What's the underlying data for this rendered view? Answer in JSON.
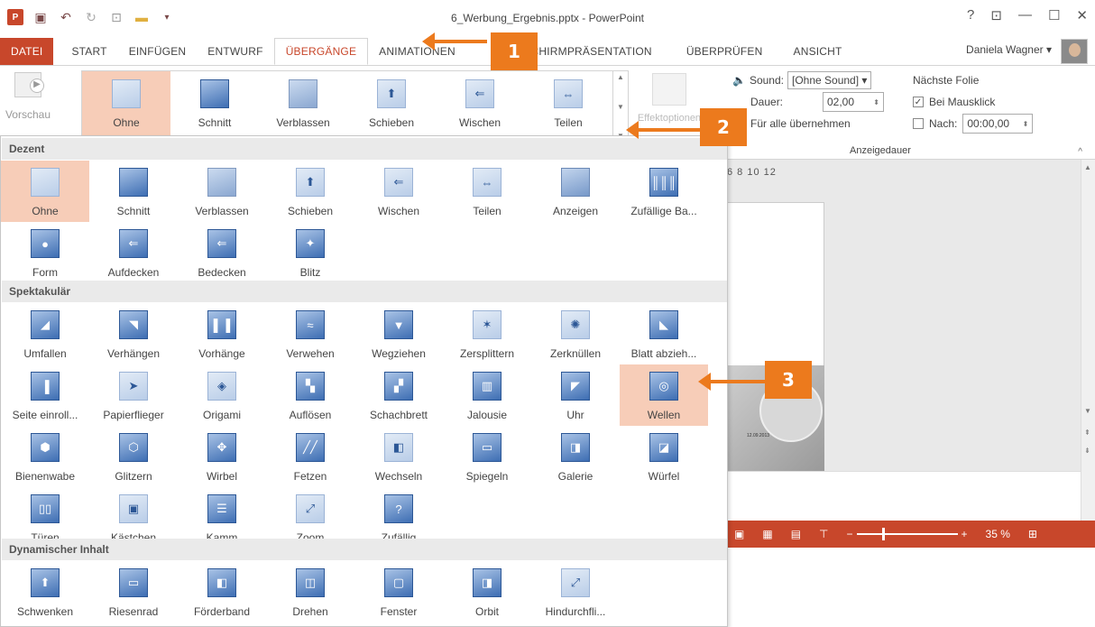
{
  "titlebar": {
    "title": "6_Werbung_Ergebnis.pptx - PowerPoint",
    "logo": "P",
    "help": "?",
    "ribbon_display": "⊡",
    "minimize": "—",
    "maximize": "☐",
    "close": "✕"
  },
  "tabs": [
    "DATEI",
    "START",
    "EINFÜGEN",
    "ENTWURF",
    "ÜBERGÄNGE",
    "ANIMATIONEN",
    "BILDSCHIRMPRÄSENTATION",
    "ÜBERPRÜFEN",
    "ANSICHT"
  ],
  "user": {
    "name": "Daniela Wagner"
  },
  "ribbon": {
    "preview_label": "Vorschau",
    "gallery": [
      "Ohne",
      "Schnitt",
      "Verblassen",
      "Schieben",
      "Wischen",
      "Teilen"
    ],
    "effect_options": "Effektoptionen",
    "sound_label": "Sound:",
    "sound_value": "[Ohne Sound]",
    "duration_label": "Dauer:",
    "duration_value": "02,00",
    "apply_all": "Für alle übernehmen",
    "next_slide_label": "Nächste Folie",
    "on_click_label": "Bei Mausklick",
    "after_label": "Nach:",
    "after_value": "00:00,00",
    "timing_group": "Anzeigedauer"
  },
  "dropdown": {
    "sections": [
      {
        "title": "Dezent",
        "items": [
          "Ohne",
          "Schnitt",
          "Verblassen",
          "Schieben",
          "Wischen",
          "Teilen",
          "Anzeigen",
          "Zufällige Ba...",
          "Form",
          "Aufdecken",
          "Bedecken",
          "Blitz"
        ]
      },
      {
        "title": "Spektakulär",
        "items": [
          "Umfallen",
          "Verhängen",
          "Vorhänge",
          "Verwehen",
          "Wegziehen",
          "Zersplittern",
          "Zerknüllen",
          "Blatt abzieh...",
          "Seite einroll...",
          "Papierflieger",
          "Origami",
          "Auflösen",
          "Schachbrett",
          "Jalousie",
          "Uhr",
          "Wellen",
          "Bienenwabe",
          "Glitzern",
          "Wirbel",
          "Fetzen",
          "Wechseln",
          "Spiegeln",
          "Galerie",
          "Würfel",
          "Türen",
          "Kästchen",
          "Kamm",
          "Zoom",
          "Zufällig"
        ]
      },
      {
        "title": "Dynamischer Inhalt",
        "items": [
          "Schwenken",
          "Riesenrad",
          "Förderband",
          "Drehen",
          "Fenster",
          "Orbit",
          "Hindurchfli..."
        ]
      }
    ]
  },
  "ruler": "6   8   10   12",
  "slide_date": "12.09.2013",
  "status": {
    "zoom": "35 %"
  },
  "callouts": [
    "1",
    "2",
    "3"
  ],
  "colors": {
    "accent": "#c8472b",
    "selection": "#f7cdb8",
    "callout": "#ec7a1d"
  }
}
